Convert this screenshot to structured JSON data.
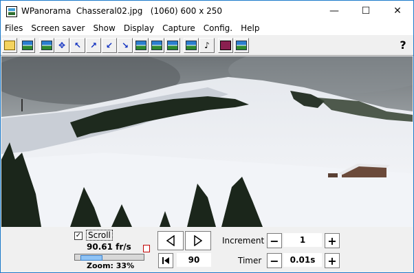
{
  "window": {
    "title": "WPanorama  Chasseral02.jpg   (1060) 600 x 250",
    "controls": {
      "minimize": "—",
      "maximize": "☐",
      "close": "✕"
    }
  },
  "menu": [
    "Files",
    "Screen saver",
    "Show",
    "Display",
    "Capture",
    "Config.",
    "Help"
  ],
  "toolbar": {
    "buttons": [
      "open-icon",
      "picture-icon",
      "fit-icon",
      "move-icon",
      "arrow-upleft-icon",
      "arrow-upright-icon",
      "arrow-downleft-icon",
      "arrow-downright-icon",
      "panorama-icon",
      "landscape-icon",
      "strip-icon",
      "scale-icon",
      "sound-icon",
      "book-icon",
      "picture-help-icon"
    ],
    "help_label": "?"
  },
  "panel": {
    "scroll_checked": true,
    "scroll_label": "Scroll",
    "fps": "90.61 fr/s",
    "zoom": "Zoom: 33%",
    "zoom_fraction": 0.33,
    "direction_value": "90",
    "increment_label": "Increment",
    "increment_value": "1",
    "timer_label": "Timer",
    "timer_value": "0.01s",
    "minus": "−",
    "plus": "+"
  }
}
